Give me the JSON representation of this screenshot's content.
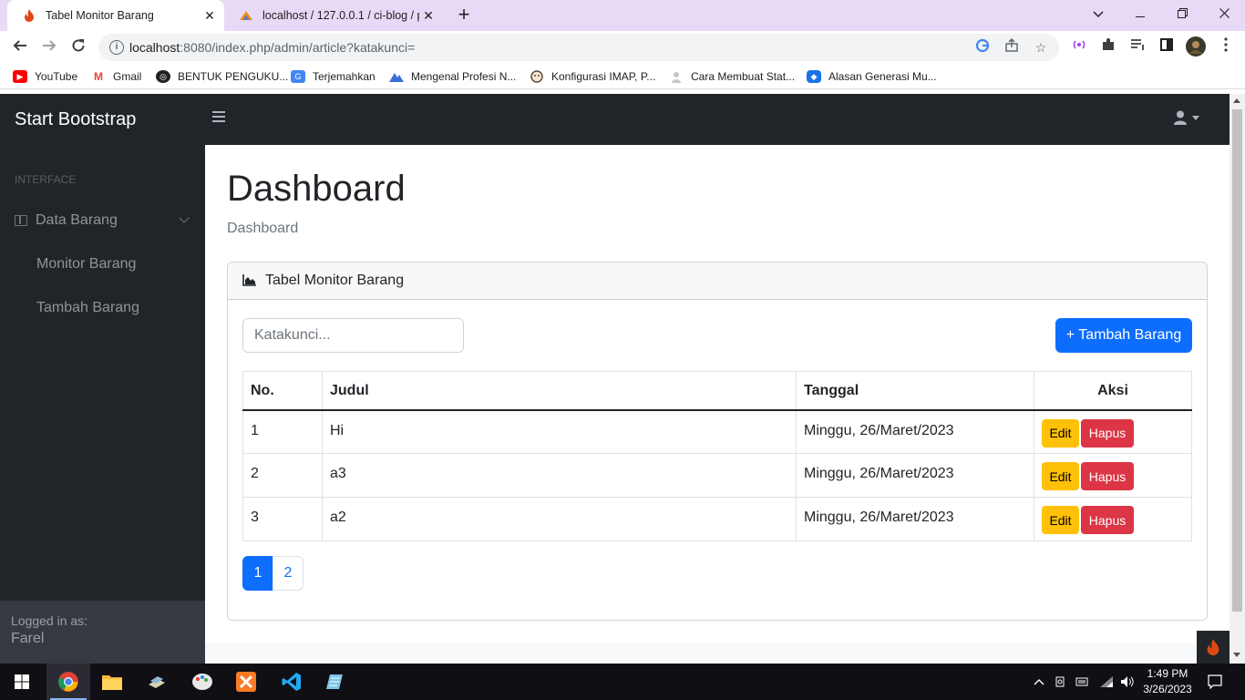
{
  "browser": {
    "tabs": [
      {
        "title": "Tabel Monitor Barang",
        "active": true
      },
      {
        "title": "localhost / 127.0.0.1 / ci-blog / p",
        "active": false
      }
    ],
    "url_host": "localhost",
    "url_rest": ":8080/index.php/admin/article?katakunci=",
    "bookmarks": [
      {
        "label": "YouTube",
        "icon": "youtube-icon",
        "color": "#ff0000"
      },
      {
        "label": "Gmail",
        "icon": "gmail-icon",
        "color": "#ea4335"
      },
      {
        "label": "BENTUK PENGUKU...",
        "icon": "globe-icon",
        "color": "#202124"
      },
      {
        "label": "Terjemahkan",
        "icon": "translate-icon",
        "color": "#4285f4"
      },
      {
        "label": "Mengenal Profesi N...",
        "icon": "mountain-icon",
        "color": "#3b6ed5"
      },
      {
        "label": "Konfigurasi IMAP, P...",
        "icon": "face-icon",
        "color": "#5f4b3a"
      },
      {
        "label": "Cara Membuat Stat...",
        "icon": "person-icon",
        "color": "#9aa0a6"
      },
      {
        "label": "Alasan Generasi Mu...",
        "icon": "diamond-icon",
        "color": "#1a73e8"
      }
    ]
  },
  "app": {
    "brand": "Start Bootstrap",
    "sidebar": {
      "heading": "Interface",
      "group_label": "Data Barang",
      "items": [
        {
          "label": "Monitor Barang"
        },
        {
          "label": "Tambah Barang"
        }
      ],
      "footer_small": "Logged in as:",
      "footer_user": "Farel"
    },
    "page_title": "Dashboard",
    "breadcrumb": "Dashboard",
    "card": {
      "title": "Tabel Monitor Barang",
      "search_placeholder": "Katakunci...",
      "add_button": "+ Tambah Barang"
    },
    "table": {
      "headers": [
        "No.",
        "Judul",
        "Tanggal",
        "Aksi"
      ],
      "rows": [
        {
          "no": "1",
          "judul": "Hi",
          "tanggal": "Minggu, 26/Maret/2023"
        },
        {
          "no": "2",
          "judul": "a3",
          "tanggal": "Minggu, 26/Maret/2023"
        },
        {
          "no": "3",
          "judul": "a2",
          "tanggal": "Minggu, 26/Maret/2023"
        }
      ],
      "edit_label": "Edit",
      "delete_label": "Hapus"
    },
    "pagination": [
      "1",
      "2"
    ],
    "pagination_active": "1"
  },
  "taskbar": {
    "time": "1:49 PM",
    "date": "3/26/2023",
    "apps": [
      "chrome-icon",
      "file-explorer-icon",
      "app-icon",
      "paint-icon",
      "xampp-icon",
      "vscode-icon",
      "notepad-icon"
    ]
  },
  "colors": {
    "primary": "#0d6efd",
    "warning": "#ffc107",
    "danger": "#dc3545",
    "dark": "#212529"
  }
}
